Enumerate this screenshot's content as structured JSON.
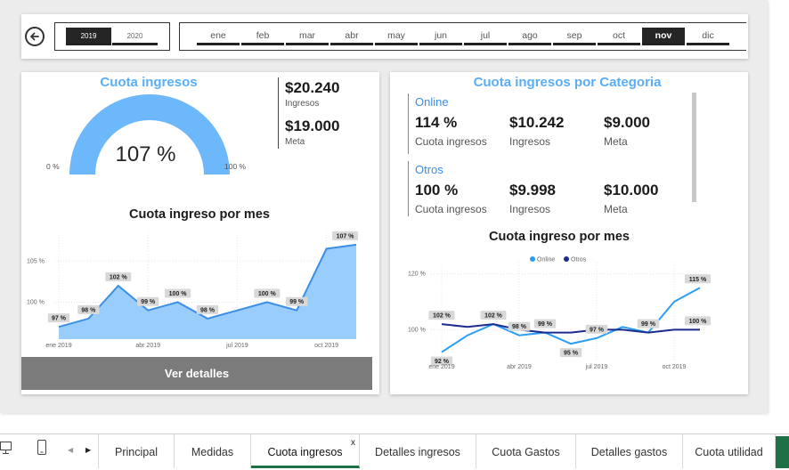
{
  "filters": {
    "years": [
      "2019",
      "2020"
    ],
    "selected_year": "2019",
    "months": [
      "ene",
      "feb",
      "mar",
      "abr",
      "may",
      "jun",
      "jul",
      "ago",
      "sep",
      "oct",
      "nov",
      "dic"
    ],
    "selected_month": "nov"
  },
  "left_card": {
    "title": "Cuota ingresos",
    "gauge": {
      "value_label": "107 %",
      "min_label": "0 %",
      "max_label": "100 %",
      "fill_fraction": 1.0
    },
    "kpis": {
      "ingresos_value": "$20.240",
      "ingresos_label": "Ingresos",
      "meta_value": "$19.000",
      "meta_label": "Meta"
    },
    "chart_title": "Cuota ingreso por mes",
    "button_label": "Ver detalles"
  },
  "right_card": {
    "title": "Cuota ingresos por Categoria",
    "categories": [
      {
        "name": "Online",
        "cuota": "114 %",
        "cuota_label": "Cuota ingresos",
        "ingresos": "$10.242",
        "ingresos_label": "Ingresos",
        "meta": "$9.000",
        "meta_label": "Meta"
      },
      {
        "name": "Otros",
        "cuota": "100 %",
        "cuota_label": "Cuota ingresos",
        "ingresos": "$9.998",
        "ingresos_label": "Ingresos",
        "meta": "$10.000",
        "meta_label": "Meta"
      }
    ],
    "chart_title": "Cuota ingreso por mes"
  },
  "chart_data": [
    {
      "type": "area",
      "title": "Cuota ingreso por mes",
      "x": [
        "ene 2019",
        "feb 2019",
        "mar 2019",
        "abr 2019",
        "may 2019",
        "jun 2019",
        "jul 2019",
        "ago 2019",
        "sep 2019",
        "oct 2019",
        "nov 2019"
      ],
      "x_tick_labels": [
        "ene 2019",
        "abr 2019",
        "jul 2019",
        "oct 2019"
      ],
      "y_tick_labels": [
        "100 %",
        "105 %"
      ],
      "values": [
        97,
        98,
        102,
        99,
        100,
        98,
        99,
        100,
        99,
        106.5,
        107
      ],
      "data_labels": [
        "97 %",
        "98 %",
        "102 %",
        "99 %",
        "100 %",
        "98 %",
        "",
        "100 %",
        "99 %",
        "",
        "107 %"
      ],
      "ylim": [
        95.5,
        108.5
      ],
      "color": "#3a8ee6",
      "fill": "#99cdfb"
    },
    {
      "type": "line",
      "title": "Cuota ingreso por mes",
      "x": [
        "ene 2019",
        "feb 2019",
        "mar 2019",
        "abr 2019",
        "may 2019",
        "jun 2019",
        "jul 2019",
        "ago 2019",
        "sep 2019",
        "oct 2019",
        "nov 2019"
      ],
      "x_tick_labels": [
        "ene 2019",
        "abr 2019",
        "jul 2019",
        "oct 2019"
      ],
      "y_tick_labels": [
        "100 %",
        "120 %"
      ],
      "legend": [
        "Online",
        "Otros"
      ],
      "legend_position": "top-center",
      "series": [
        {
          "name": "Online",
          "color": "#2a9df4",
          "values": [
            92,
            98,
            102,
            98,
            99,
            95,
            97,
            101,
            99,
            110,
            115
          ],
          "data_labels": [
            "92 %",
            "",
            "",
            "98 %",
            "",
            "95 %",
            "97 %",
            "",
            "99 %",
            "",
            "115 %"
          ]
        },
        {
          "name": "Otros",
          "color": "#1b2c8f",
          "values": [
            102,
            101,
            102,
            100,
            99,
            99,
            100,
            100,
            99,
            100,
            100
          ],
          "data_labels": [
            "102 %",
            "",
            "102 %",
            "",
            "99 %",
            "",
            "",
            "",
            "",
            "",
            "100 %"
          ]
        }
      ],
      "ylim": [
        89,
        124
      ]
    }
  ],
  "tabs": {
    "items": [
      "Principal",
      "Medidas",
      "Cuota ingresos",
      "Detalles ingresos",
      "Cuota Gastos",
      "Detalles gastos",
      "Cuota utilidad"
    ],
    "active": "Cuota ingresos",
    "close_label": "x"
  }
}
